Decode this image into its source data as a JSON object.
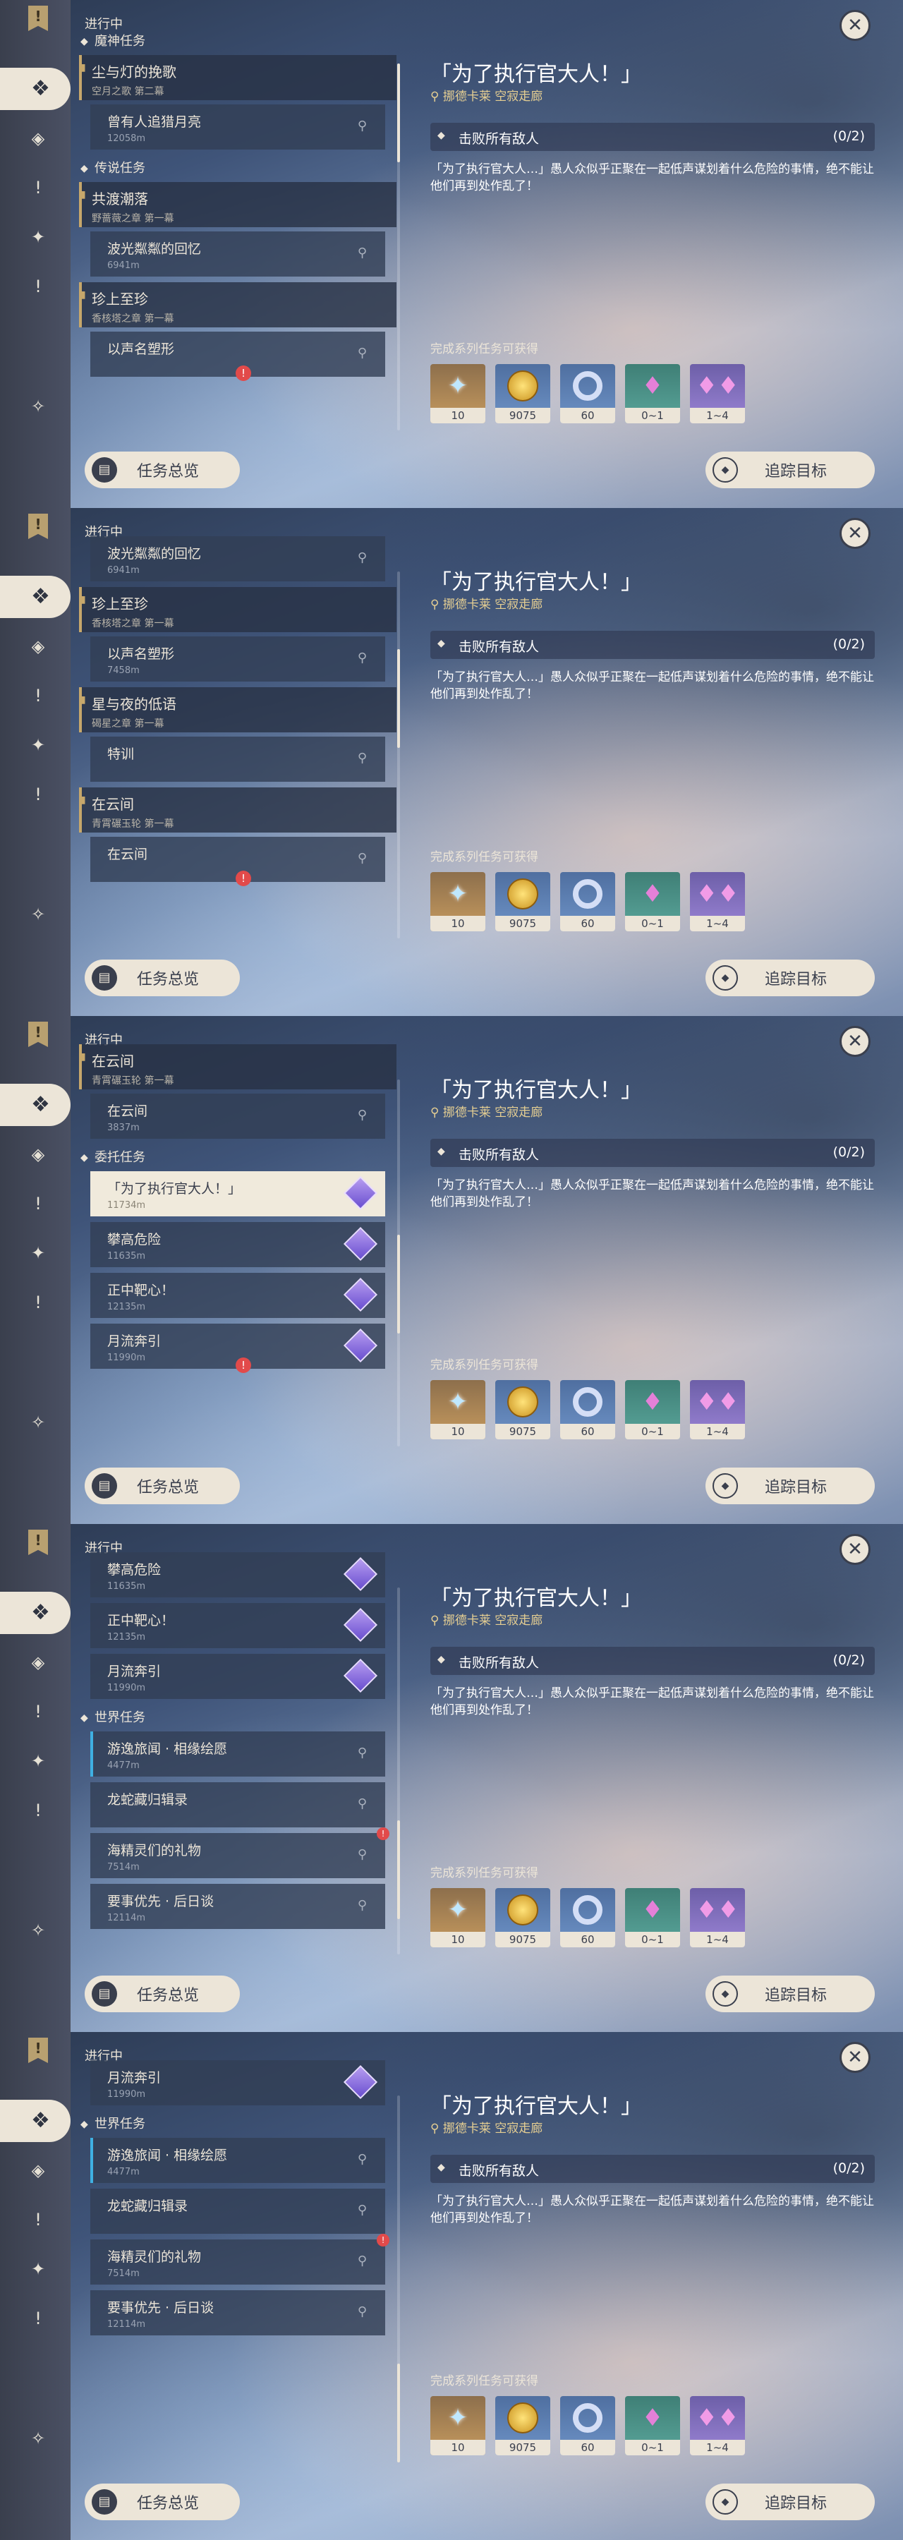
{
  "common": {
    "in_progress": "进行中",
    "quest_title": "「为了执行官大人！」",
    "quest_location": "挪德卡莱 空寂走廊",
    "objective": "击败所有敌人",
    "objective_progress": "(0/2)",
    "description": "「为了执行官大人…」愚人众似乎正聚在一起低声谋划着什么危险的事情，绝不能让他们再到处作乱了！",
    "rewards_label": "完成系列任务可获得",
    "rewards": [
      "10",
      "9075",
      "60",
      "0~1",
      "1~4"
    ],
    "overview_btn": "任务总览",
    "track_btn": "追踪目标"
  },
  "panels": [
    {
      "sections": [
        {
          "type": "section",
          "label": "魔神任务"
        },
        {
          "type": "chapter",
          "title": "尘与灯的挽歌",
          "sub": "空月之歌 第二幕"
        },
        {
          "type": "item",
          "title": "曾有人追猎月亮",
          "dist": "12058m",
          "pin": true
        },
        {
          "type": "section",
          "label": "传说任务"
        },
        {
          "type": "chapter",
          "title": "共渡潮落",
          "sub": "野蔷薇之章 第一幕"
        },
        {
          "type": "item",
          "title": "波光粼粼的回忆",
          "dist": "6941m",
          "pin": true
        },
        {
          "type": "chapter",
          "title": "珍上至珍",
          "sub": "香核塔之章 第一幕"
        },
        {
          "type": "item",
          "title": "以声名塑形",
          "dist": "",
          "pin": true,
          "badge": true
        }
      ]
    },
    {
      "sections": [
        {
          "type": "item",
          "title": "波光粼粼的回忆",
          "dist": "6941m",
          "pin": true
        },
        {
          "type": "chapter",
          "title": "珍上至珍",
          "sub": "香核塔之章 第一幕"
        },
        {
          "type": "item",
          "title": "以声名塑形",
          "dist": "7458m",
          "pin": true
        },
        {
          "type": "chapter",
          "title": "星与夜的低语",
          "sub": "碣星之章 第一幕"
        },
        {
          "type": "item",
          "title": "特训",
          "dist": "",
          "pin": true
        },
        {
          "type": "chapter",
          "title": "在云间",
          "sub": "青霄碾玉轮 第一幕"
        },
        {
          "type": "item",
          "title": "在云间",
          "dist": "",
          "pin": true,
          "badge": true
        }
      ]
    },
    {
      "sections": [
        {
          "type": "chapter",
          "title": "在云间",
          "sub": "青霄碾玉轮 第一幕"
        },
        {
          "type": "item",
          "title": "在云间",
          "dist": "3837m",
          "pin": true
        },
        {
          "type": "section",
          "label": "委托任务"
        },
        {
          "type": "item",
          "title": "「为了执行官大人！」",
          "dist": "11734m",
          "gem": true,
          "sel": true
        },
        {
          "type": "item",
          "title": "攀高危险",
          "dist": "11635m",
          "gem": true
        },
        {
          "type": "item",
          "title": "正中靶心！",
          "dist": "12135m",
          "gem": true
        },
        {
          "type": "item",
          "title": "月流奔引",
          "dist": "11990m",
          "gem": true,
          "badge": true
        }
      ]
    },
    {
      "sections": [
        {
          "type": "item",
          "title": "攀高危险",
          "dist": "11635m",
          "gem": true
        },
        {
          "type": "item",
          "title": "正中靶心！",
          "dist": "12135m",
          "gem": true
        },
        {
          "type": "item",
          "title": "月流奔引",
          "dist": "11990m",
          "gem": true
        },
        {
          "type": "section",
          "label": "世界任务"
        },
        {
          "type": "item",
          "title": "游逸旅闻 · 相缘绘愿",
          "dist": "4477m",
          "pin": true,
          "blue": true
        },
        {
          "type": "item",
          "title": "龙蛇藏归辑录",
          "dist": "",
          "pin": true
        },
        {
          "type": "item",
          "title": "海精灵们的礼物",
          "dist": "7514m",
          "pin": true,
          "badge2": true
        },
        {
          "type": "item",
          "title": "要事优先 · 后日谈",
          "dist": "12114m",
          "pin": true
        }
      ]
    },
    {
      "sections": [
        {
          "type": "item",
          "title": "月流奔引",
          "dist": "11990m",
          "gem": true
        },
        {
          "type": "section",
          "label": "世界任务"
        },
        {
          "type": "item",
          "title": "游逸旅闻 · 相缘绘愿",
          "dist": "4477m",
          "pin": true,
          "blue": true
        },
        {
          "type": "item",
          "title": "龙蛇藏归辑录",
          "dist": "",
          "pin": true
        },
        {
          "type": "item",
          "title": "海精灵们的礼物",
          "dist": "7514m",
          "pin": true,
          "badge2": true
        },
        {
          "type": "item",
          "title": "要事优先 · 后日谈",
          "dist": "12114m",
          "pin": true
        }
      ]
    }
  ],
  "icons": {
    "pin": "location-pin-icon",
    "gem": "commission-gem-icon",
    "badge": "exclamation-icon"
  }
}
